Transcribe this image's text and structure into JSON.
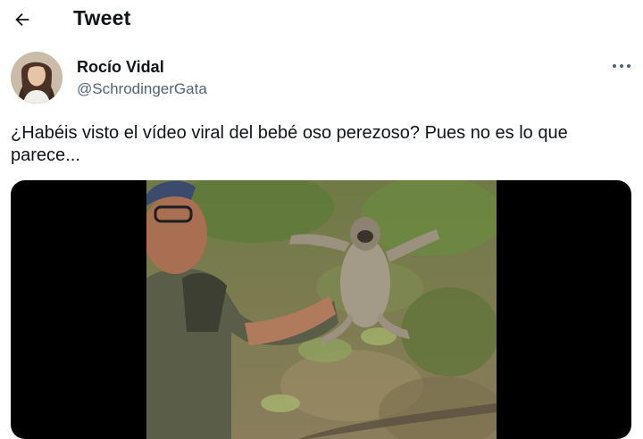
{
  "header": {
    "title": "Tweet"
  },
  "author": {
    "display_name": "Rocío Vidal",
    "handle": "@SchrodingerGata"
  },
  "tweet": {
    "text": "¿Habéis visto el vídeo viral del bebé oso perezoso? Pues no es lo que parece..."
  },
  "icons": {
    "back": "back-arrow-icon",
    "more": "more-horizontal-icon"
  },
  "colors": {
    "text_primary": "#0f1419",
    "text_secondary": "#536471",
    "media_background": "#000000",
    "page_background": "#ffffff"
  }
}
